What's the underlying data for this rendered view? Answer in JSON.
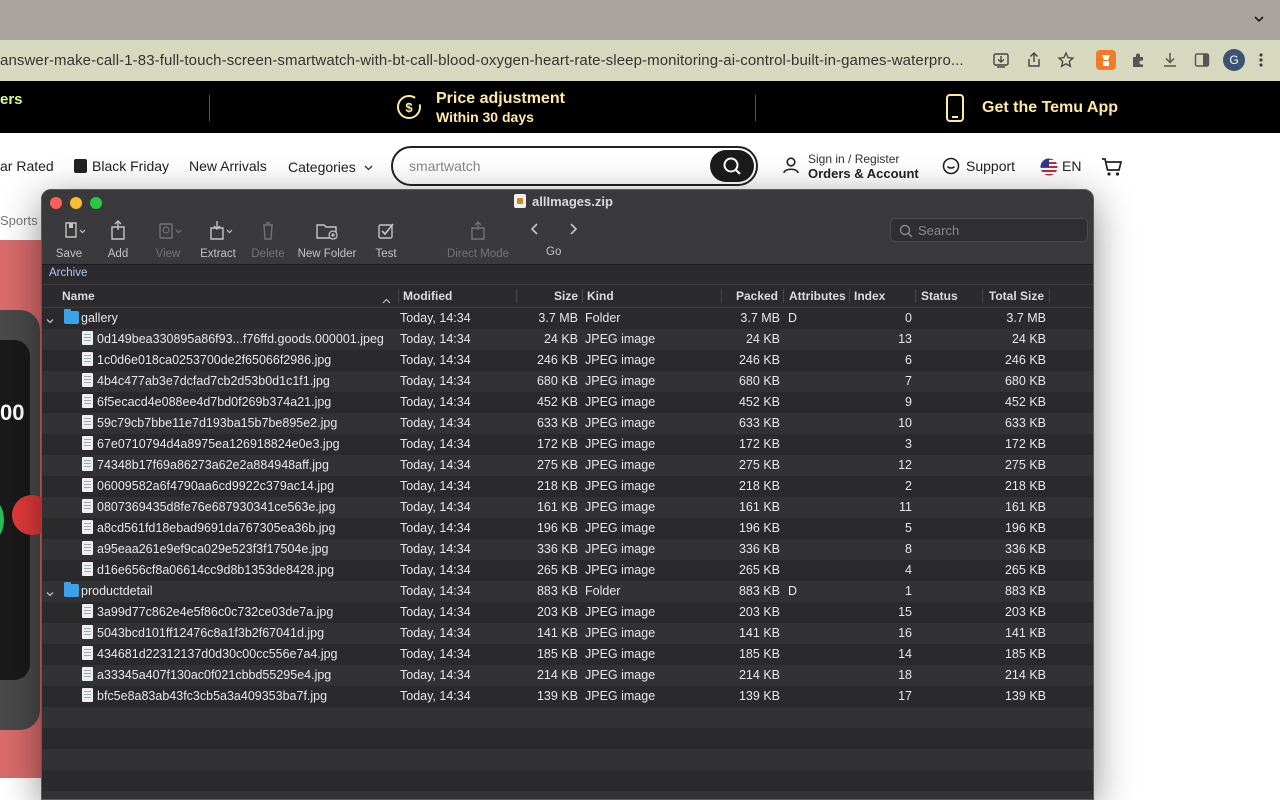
{
  "browser": {
    "url": "answer-make-call-1-83-full-touch-screen-smartwatch-with-bt-call-blood-oxygen-heart-rate-sleep-monitoring-ai-control-built-in-games-waterpro...",
    "profile_initial": "G"
  },
  "site": {
    "promo": {
      "left_text": "ers",
      "price_title": "Price adjustment",
      "price_sub": "Within 30 days",
      "app_text": "Get the Temu App"
    },
    "nav": {
      "star_rated": "ar Rated",
      "black_friday": "Black Friday",
      "new_arrivals": "New Arrivals",
      "categories": "Categories",
      "search_placeholder": "smartwatch",
      "sign_in": "Sign in / Register",
      "orders": "Orders & Account",
      "support": "Support",
      "lang": "EN"
    },
    "breadcrumb": "Sports",
    "product_number": "00"
  },
  "archive": {
    "title": "allImages.zip",
    "toolbar": {
      "save": "Save",
      "add": "Add",
      "view": "View",
      "extract": "Extract",
      "delete": "Delete",
      "new_folder": "New Folder",
      "test": "Test",
      "direct_mode": "Direct Mode",
      "go": "Go"
    },
    "search_placeholder": "Search",
    "path": "Archive",
    "columns": {
      "name": "Name",
      "modified": "Modified",
      "size": "Size",
      "kind": "Kind",
      "packed": "Packed",
      "attributes": "Attributes",
      "index": "Index",
      "status": "Status",
      "total_size": "Total Size"
    },
    "rows": [
      {
        "name": "gallery",
        "modified": "Today, 14:34",
        "size": "3.7 MB",
        "kind": "Folder",
        "packed": "3.7 MB",
        "attr": "D",
        "index": "0",
        "total": "3.7 MB",
        "folder": true
      },
      {
        "name": "0d149bea330895a86f93...f76ffd.goods.000001.jpeg",
        "modified": "Today, 14:34",
        "size": "24 KB",
        "kind": "JPEG image",
        "packed": "24 KB",
        "attr": "",
        "index": "13",
        "total": "24 KB"
      },
      {
        "name": "1c0d6e018ca0253700de2f65066f2986.jpg",
        "modified": "Today, 14:34",
        "size": "246 KB",
        "kind": "JPEG image",
        "packed": "246 KB",
        "attr": "",
        "index": "6",
        "total": "246 KB"
      },
      {
        "name": "4b4c477ab3e7dcfad7cb2d53b0d1c1f1.jpg",
        "modified": "Today, 14:34",
        "size": "680 KB",
        "kind": "JPEG image",
        "packed": "680 KB",
        "attr": "",
        "index": "7",
        "total": "680 KB"
      },
      {
        "name": "6f5ecacd4e088ee4d7bd0f269b374a21.jpg",
        "modified": "Today, 14:34",
        "size": "452 KB",
        "kind": "JPEG image",
        "packed": "452 KB",
        "attr": "",
        "index": "9",
        "total": "452 KB"
      },
      {
        "name": "59c79cb7bbe11e7d193ba15b7be895e2.jpg",
        "modified": "Today, 14:34",
        "size": "633 KB",
        "kind": "JPEG image",
        "packed": "633 KB",
        "attr": "",
        "index": "10",
        "total": "633 KB"
      },
      {
        "name": "67e0710794d4a8975ea126918824e0e3.jpg",
        "modified": "Today, 14:34",
        "size": "172 KB",
        "kind": "JPEG image",
        "packed": "172 KB",
        "attr": "",
        "index": "3",
        "total": "172 KB"
      },
      {
        "name": "74348b17f69a86273a62e2a884948aff.jpg",
        "modified": "Today, 14:34",
        "size": "275 KB",
        "kind": "JPEG image",
        "packed": "275 KB",
        "attr": "",
        "index": "12",
        "total": "275 KB"
      },
      {
        "name": "06009582a6f4790aa6cd9922c379ac14.jpg",
        "modified": "Today, 14:34",
        "size": "218 KB",
        "kind": "JPEG image",
        "packed": "218 KB",
        "attr": "",
        "index": "2",
        "total": "218 KB"
      },
      {
        "name": "0807369435d8fe76e687930341ce563e.jpg",
        "modified": "Today, 14:34",
        "size": "161 KB",
        "kind": "JPEG image",
        "packed": "161 KB",
        "attr": "",
        "index": "11",
        "total": "161 KB"
      },
      {
        "name": "a8cd561fd18ebad9691da767305ea36b.jpg",
        "modified": "Today, 14:34",
        "size": "196 KB",
        "kind": "JPEG image",
        "packed": "196 KB",
        "attr": "",
        "index": "5",
        "total": "196 KB"
      },
      {
        "name": "a95eaa261e9ef9ca029e523f3f17504e.jpg",
        "modified": "Today, 14:34",
        "size": "336 KB",
        "kind": "JPEG image",
        "packed": "336 KB",
        "attr": "",
        "index": "8",
        "total": "336 KB"
      },
      {
        "name": "d16e656cf8a06614cc9d8b1353de8428.jpg",
        "modified": "Today, 14:34",
        "size": "265 KB",
        "kind": "JPEG image",
        "packed": "265 KB",
        "attr": "",
        "index": "4",
        "total": "265 KB"
      },
      {
        "name": "productdetail",
        "modified": "Today, 14:34",
        "size": "883 KB",
        "kind": "Folder",
        "packed": "883 KB",
        "attr": "D",
        "index": "1",
        "total": "883 KB",
        "folder": true
      },
      {
        "name": "3a99d77c862e4e5f86c0c732ce03de7a.jpg",
        "modified": "Today, 14:34",
        "size": "203 KB",
        "kind": "JPEG image",
        "packed": "203 KB",
        "attr": "",
        "index": "15",
        "total": "203 KB"
      },
      {
        "name": "5043bcd101ff12476c8a1f3b2f67041d.jpg",
        "modified": "Today, 14:34",
        "size": "141 KB",
        "kind": "JPEG image",
        "packed": "141 KB",
        "attr": "",
        "index": "16",
        "total": "141 KB"
      },
      {
        "name": "434681d22312137d0d30c00cc556e7a4.jpg",
        "modified": "Today, 14:34",
        "size": "185 KB",
        "kind": "JPEG image",
        "packed": "185 KB",
        "attr": "",
        "index": "14",
        "total": "185 KB"
      },
      {
        "name": "a33345a407f130ac0f021cbbd55295e4.jpg",
        "modified": "Today, 14:34",
        "size": "214 KB",
        "kind": "JPEG image",
        "packed": "214 KB",
        "attr": "",
        "index": "18",
        "total": "214 KB"
      },
      {
        "name": "bfc5e8a83ab43fc3cb5a3a409353ba7f.jpg",
        "modified": "Today, 14:34",
        "size": "139 KB",
        "kind": "JPEG image",
        "packed": "139 KB",
        "attr": "",
        "index": "17",
        "total": "139 KB"
      }
    ]
  },
  "colors": {
    "promo_text": "#ffe9a3",
    "window_bg": "#2a2a2c",
    "folder_blue": "#3da1e8"
  }
}
